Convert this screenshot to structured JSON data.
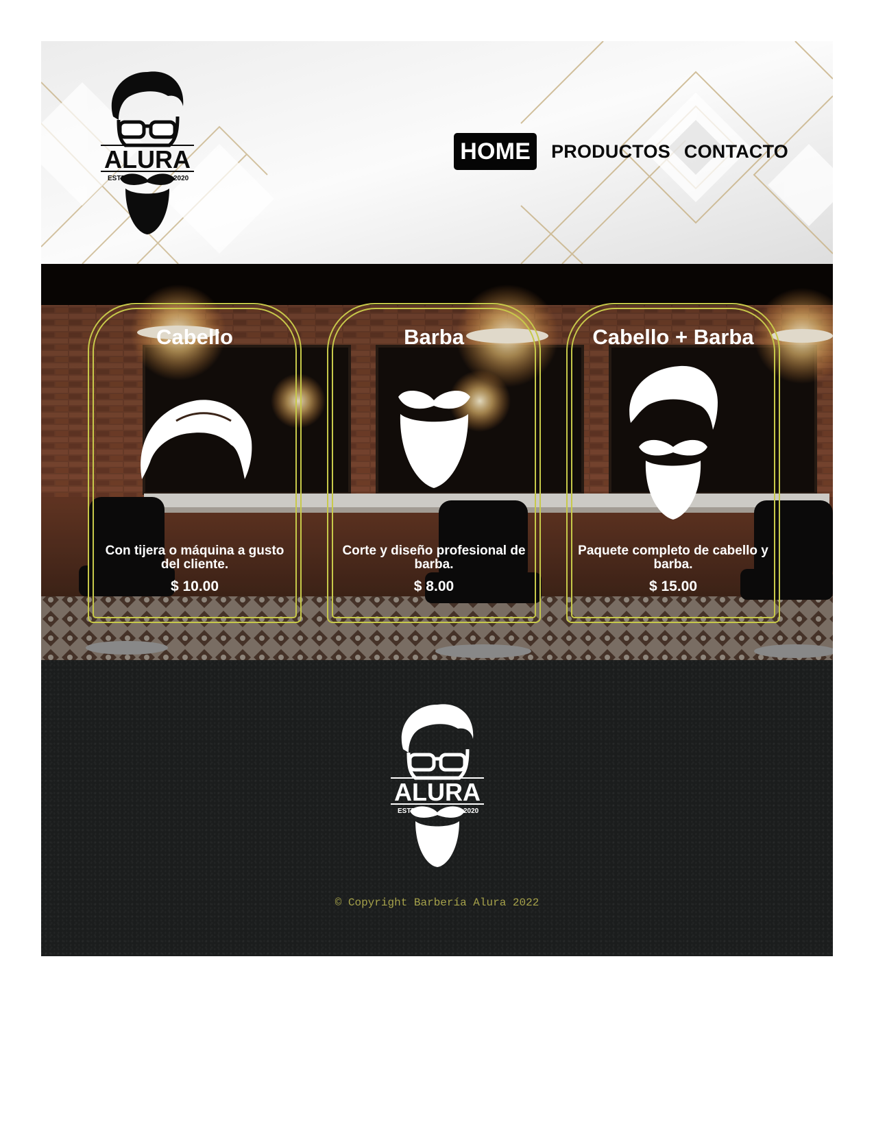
{
  "brand": {
    "name": "ALURA",
    "estd_left": "ESTD",
    "estd_right": "2020"
  },
  "nav": {
    "items": [
      {
        "label": "HOME",
        "active": true
      },
      {
        "label": "PRODUCTOS",
        "active": false
      },
      {
        "label": "CONTACTO",
        "active": false
      }
    ]
  },
  "services": [
    {
      "title": "Cabello",
      "description": "Con tijera o máquina a gusto del cliente.",
      "price": "$ 10.00",
      "icon": "hair-icon"
    },
    {
      "title": "Barba",
      "description": "Corte y diseño profesional de barba.",
      "price": "$ 8.00",
      "icon": "beard-icon"
    },
    {
      "title": "Cabello + Barba",
      "description": "Paquete completo de cabello y barba.",
      "price": "$ 15.00",
      "icon": "hair-beard-icon"
    }
  ],
  "footer": {
    "copyright": "© Copyright Barbería Alura 2022"
  },
  "colors": {
    "card_border": "#c7c94a",
    "footer_bg": "#1b1d1d",
    "copyright": "#a6a24a",
    "nav_active_bg": "#050505"
  }
}
